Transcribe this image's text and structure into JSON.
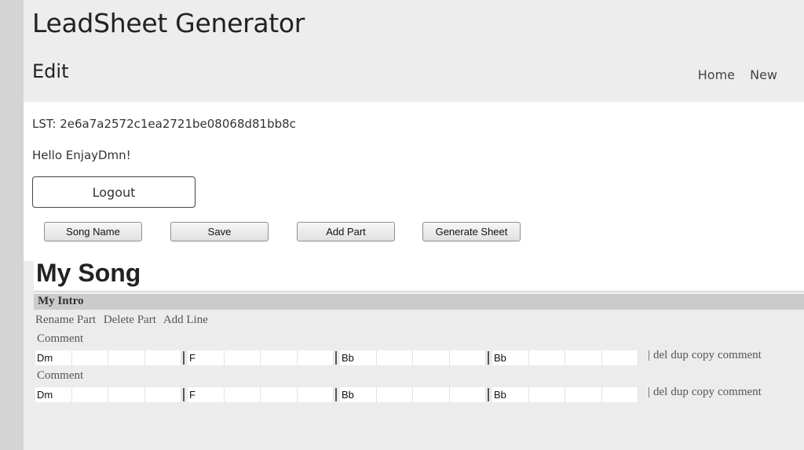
{
  "header": {
    "app_title": "LeadSheet Generator",
    "page_heading": "Edit",
    "nav": [
      "Home",
      "New"
    ]
  },
  "session": {
    "lst": "LST: 2e6a7a2572c1ea2721be08068d81bb8c",
    "greeting": "Hello EnjayDmn!",
    "logout_label": "Logout"
  },
  "toolbar": {
    "song_name_label": "Song Name",
    "save_label": "Save",
    "add_part_label": "Add Part",
    "generate_sheet_label": "Generate Sheet"
  },
  "song": {
    "title": "My Song",
    "parts": [
      {
        "name": "My Intro",
        "actions": [
          "Rename Part",
          "Delete Part",
          "Add Line"
        ],
        "lines": [
          {
            "comment": "Comment",
            "measures": [
              [
                "Dm",
                "",
                "",
                ""
              ],
              [
                "F",
                "",
                "",
                ""
              ],
              [
                "Bb",
                "",
                "",
                ""
              ],
              [
                "Bb",
                "",
                "",
                ""
              ]
            ],
            "actions": [
              "del",
              "dup",
              "copy",
              "comment"
            ]
          },
          {
            "comment": "Comment",
            "measures": [
              [
                "Dm",
                "",
                "",
                ""
              ],
              [
                "F",
                "",
                "",
                ""
              ],
              [
                "Bb",
                "",
                "",
                ""
              ],
              [
                "Bb",
                "",
                "",
                ""
              ]
            ],
            "actions": [
              "del",
              "dup",
              "copy",
              "comment"
            ]
          }
        ]
      }
    ]
  }
}
